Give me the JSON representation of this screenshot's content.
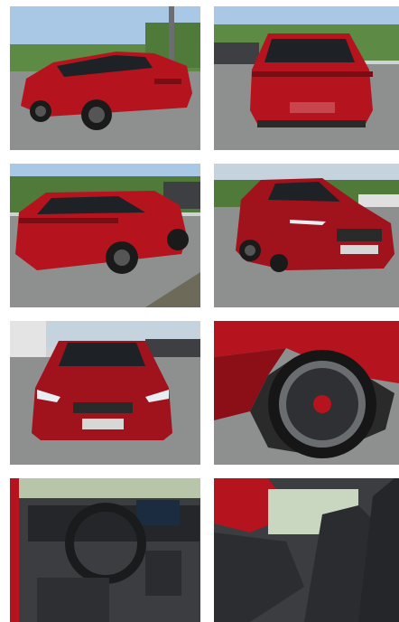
{
  "gallery": {
    "photos": [
      {
        "subject": "car-rear-three-quarter-left",
        "alt": ""
      },
      {
        "subject": "car-rear",
        "alt": ""
      },
      {
        "subject": "car-rear-three-quarter-left-closeup",
        "alt": ""
      },
      {
        "subject": "car-front-three-quarter-right",
        "alt": ""
      },
      {
        "subject": "car-front",
        "alt": ""
      },
      {
        "subject": "car-wheel",
        "alt": ""
      },
      {
        "subject": "car-dashboard-interior",
        "alt": ""
      },
      {
        "subject": "car-front-seats-interior",
        "alt": ""
      }
    ]
  },
  "colors": {
    "car_red": "#b5141f",
    "car_red_dark": "#7a0c14",
    "sky": "#a9c8e6",
    "asphalt": "#8e8f8f",
    "tree": "#4f7a3a",
    "interior": "#3b3d40"
  }
}
